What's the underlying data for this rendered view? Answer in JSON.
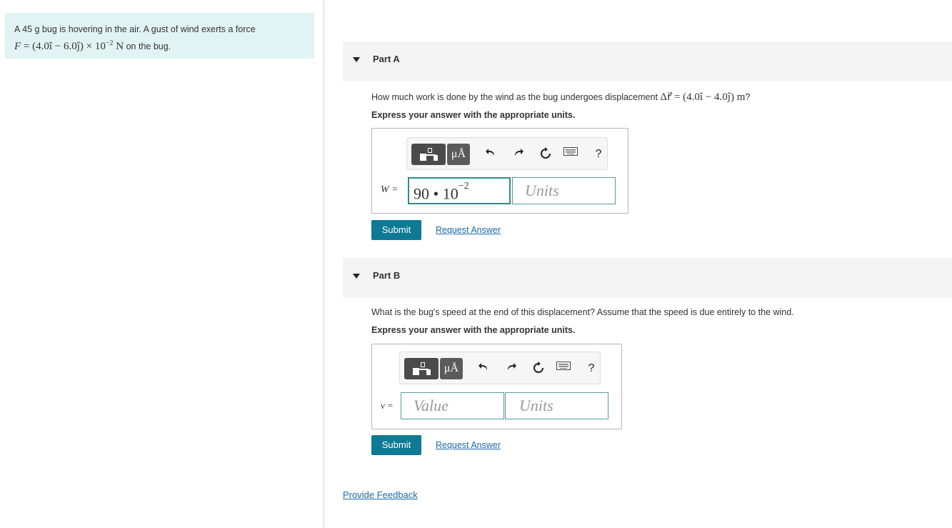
{
  "problem": {
    "text_before": "A 45 g bug is hovering in the air. A gust of wind exerts a force",
    "force_symbol": "F",
    "force_expr": " = (4.0î − 6.0ĵ) × 10",
    "force_exp": "−2",
    "force_unit": " N",
    "text_after": " on the bug."
  },
  "partA": {
    "title": "Part A",
    "question": "How much work is done by the wind as the bug undergoes displacement",
    "question_math": "Δr⃗ = (4.0î − 4.0ĵ) m",
    "question_end": "?",
    "express": "Express your answer with the appropriate units.",
    "var_label": "W =",
    "value_main": "90 • 10",
    "value_exp": "−2",
    "units_placeholder": "Units",
    "submit": "Submit",
    "request_answer": "Request Answer"
  },
  "partB": {
    "title": "Part B",
    "question": "What is the bug's speed at the end of this displacement? Assume that the speed is due entirely to the wind.",
    "express": "Express your answer with the appropriate units.",
    "var_label": "v =",
    "value_placeholder": "Value",
    "units_placeholder": "Units",
    "submit": "Submit",
    "request_answer": "Request Answer"
  },
  "toolbar": {
    "mu_label": "μÅ",
    "help_label": "?",
    "icons": [
      "templates-icon",
      "units-icon",
      "undo-icon",
      "redo-icon",
      "reset-icon",
      "keyboard-icon",
      "help-icon"
    ]
  },
  "footer": {
    "feedback": "Provide Feedback"
  }
}
